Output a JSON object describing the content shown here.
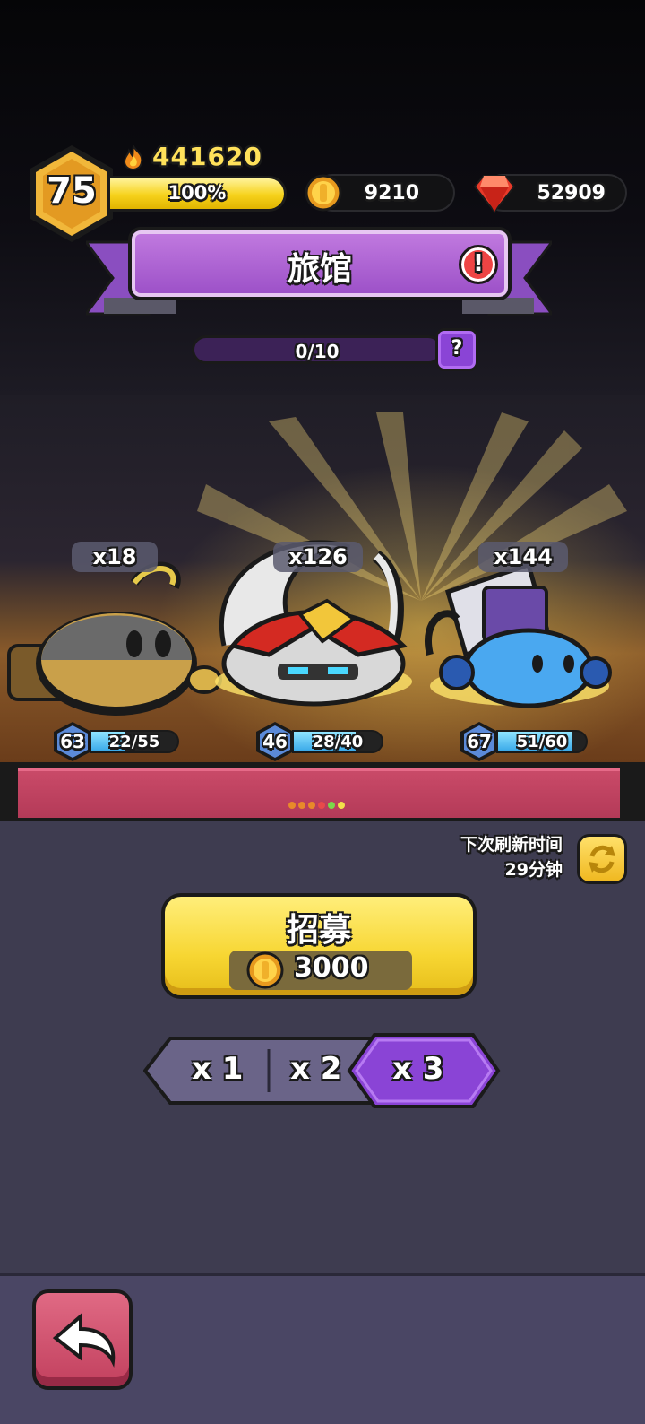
{
  "hud": {
    "level": "75",
    "power": "441620",
    "xp_percent_label": "100%",
    "xp_fraction": 1.0,
    "gold": "9210",
    "gems": "52909"
  },
  "title": {
    "text": "旅馆",
    "alert": "!"
  },
  "progress": {
    "text": "0/10",
    "help": "?"
  },
  "heroes": [
    {
      "name": "yellow-slime",
      "count": "x18",
      "level": "63",
      "hp": "22/55",
      "hp_fraction": 0.4
    },
    {
      "name": "red-armored-slime",
      "count": "x126",
      "level": "46",
      "hp": "28/40",
      "hp_fraction": 0.7
    },
    {
      "name": "blue-tank-slime",
      "count": "x144",
      "level": "67",
      "hp": "51/60",
      "hp_fraction": 0.85
    }
  ],
  "refresh": {
    "line1": "下次刷新时间",
    "line2": "29分钟"
  },
  "recruit": {
    "label": "招募",
    "cost": "3000"
  },
  "multipliers": [
    "x 1",
    "x 2",
    "x 3"
  ],
  "selected_multiplier": "x 3",
  "colors": {
    "accent_purple": "#9b4fc7",
    "gold": "#f7d632",
    "back_red": "#c2405e"
  }
}
